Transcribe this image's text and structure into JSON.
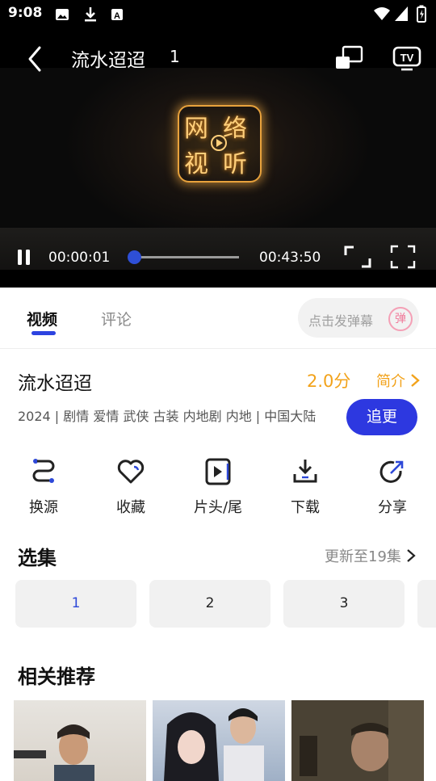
{
  "status_bar": {
    "time": "9:08"
  },
  "player": {
    "title": "流水迢迢",
    "episode": "1",
    "logo_chars": [
      "网",
      "络",
      "视",
      "听"
    ],
    "current_time": "00:00:01",
    "total_time": "00:43:50",
    "progress": 0.0004
  },
  "tabs": [
    {
      "label": "视频",
      "active": true
    },
    {
      "label": "评论",
      "active": false
    }
  ],
  "danmaku": {
    "placeholder": "点击发弹幕",
    "badge": "弹"
  },
  "info": {
    "title": "流水迢迢",
    "score": "2.0分",
    "intro_label": "简介",
    "meta": "2024 | 剧情 爱情 武侠 古装 内地剧 内地 | 中国大陆",
    "follow_label": "追更"
  },
  "actions": [
    {
      "label": "换源",
      "icon": "switch-source-icon"
    },
    {
      "label": "收藏",
      "icon": "heart-icon"
    },
    {
      "label": "片头/尾",
      "icon": "play-skip-icon"
    },
    {
      "label": "下载",
      "icon": "download-icon"
    },
    {
      "label": "分享",
      "icon": "share-icon"
    }
  ],
  "episodes_section": {
    "title": "选集",
    "update_text": "更新至19集",
    "episodes": [
      "1",
      "2",
      "3"
    ]
  },
  "recommend_section": {
    "title": "相关推荐"
  },
  "colors": {
    "accent": "#2d38e0",
    "score": "#f2a21a"
  }
}
